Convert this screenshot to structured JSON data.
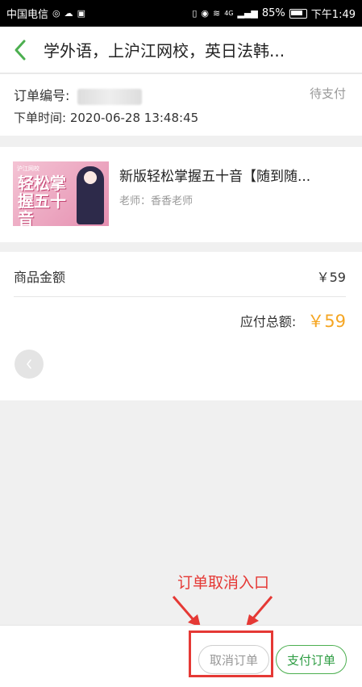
{
  "statusbar": {
    "carrier": "中国电信",
    "battery_pct": "85%",
    "time": "下午1:49",
    "network": "4G"
  },
  "nav": {
    "title": "学外语，上沪江网校，英日法韩..."
  },
  "order": {
    "number_label": "订单编号:",
    "status": "待支付",
    "time_label": "下单时间:",
    "time_value": "2020-06-28 13:48:45"
  },
  "product": {
    "thumb_text": "轻松掌握五十音",
    "thumb_brand": "沪江网校",
    "title": "新版轻松掌握五十音【随到随...",
    "teacher": "老师：香香老师"
  },
  "amount": {
    "goods_label": "商品金额",
    "goods_value": "￥59",
    "total_label": "应付总额:",
    "total_value": "￥59"
  },
  "annotation": {
    "text": "订单取消入口"
  },
  "bottom": {
    "cancel_label": "取消订单",
    "pay_label": "支付订单"
  },
  "colors": {
    "accent_green": "#4caf50",
    "price_orange": "#f5a623",
    "annotation_red": "#e53935"
  }
}
